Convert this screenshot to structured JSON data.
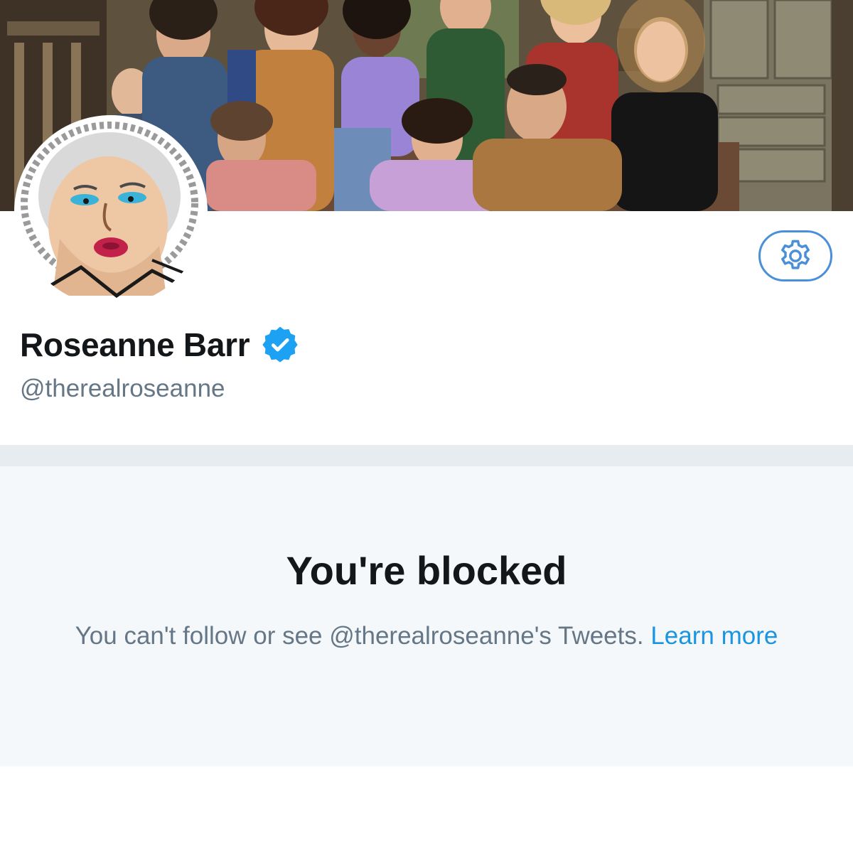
{
  "profile": {
    "display_name": "Roseanne Barr",
    "handle": "@therealroseanne",
    "verified": true,
    "verified_icon": "verified-badge-icon",
    "settings_icon": "gear-icon"
  },
  "blocked": {
    "title": "You're blocked",
    "message": "You can't follow or see @therealroseanne's Tweets.",
    "link_label": "Learn more"
  },
  "colors": {
    "accent": "#1b95e0",
    "verified": "#1da1f2",
    "title_text": "#14171a",
    "secondary_text": "#657786",
    "panel_bg": "#f5f8fa",
    "divider": "#e6ecf0"
  }
}
